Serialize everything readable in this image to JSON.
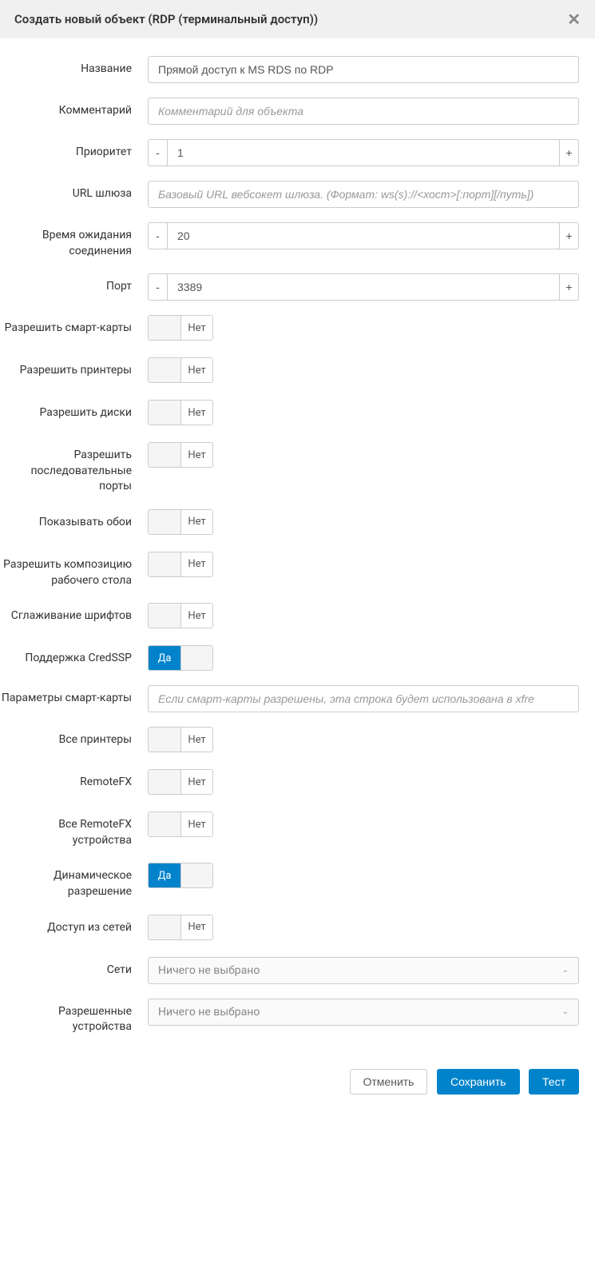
{
  "header": {
    "title": "Создать новый объект (RDP (терминальный доступ))"
  },
  "form": {
    "name": {
      "label": "Название",
      "value": "Прямой доступ к MS RDS по RDP"
    },
    "comment": {
      "label": "Комментарий",
      "placeholder": "Комментарий для объекта"
    },
    "priority": {
      "label": "Приоритет",
      "value": "1"
    },
    "gateway_url": {
      "label": "URL шлюза",
      "placeholder": "Базовый URL вебсокет шлюза. (Формат: ws(s)://<хост>[:порт][/путь])"
    },
    "conn_timeout": {
      "label": "Время ожидания соединения",
      "value": "20"
    },
    "port": {
      "label": "Порт",
      "value": "3389"
    },
    "allow_smartcards": {
      "label": "Разрешить смарт-карты",
      "value": "Нет",
      "on": false
    },
    "allow_printers": {
      "label": "Разрешить принтеры",
      "value": "Нет",
      "on": false
    },
    "allow_drives": {
      "label": "Разрешить диски",
      "value": "Нет",
      "on": false
    },
    "allow_serial": {
      "label": "Разрешить последовательные порты",
      "value": "Нет",
      "on": false
    },
    "show_wallpaper": {
      "label": "Показывать обои",
      "value": "Нет",
      "on": false
    },
    "allow_composition": {
      "label": "Разрешить композицию рабочего стола",
      "value": "Нет",
      "on": false
    },
    "font_smoothing": {
      "label": "Сглаживание шрифтов",
      "value": "Нет",
      "on": false
    },
    "credssp": {
      "label": "Поддержка CredSSP",
      "value": "Да",
      "on": true
    },
    "smartcard_params": {
      "label": "Параметры смарт-карты",
      "placeholder": "Если смарт-карты разрешены, эта строка будет использована в xfre"
    },
    "all_printers": {
      "label": "Все принтеры",
      "value": "Нет",
      "on": false
    },
    "remotefx": {
      "label": "RemoteFX",
      "value": "Нет",
      "on": false
    },
    "all_remotefx": {
      "label": "Все RemoteFX устройства",
      "value": "Нет",
      "on": false
    },
    "dynamic_res": {
      "label": "Динамическое разрешение",
      "value": "Да",
      "on": true
    },
    "net_access": {
      "label": "Доступ из сетей",
      "value": "Нет",
      "on": false
    },
    "networks": {
      "label": "Сети",
      "selected": "Ничего не выбрано"
    },
    "allowed_devices": {
      "label": "Разрешенные устройства",
      "selected": "Ничего не выбрано"
    }
  },
  "footer": {
    "cancel": "Отменить",
    "save": "Сохранить",
    "test": "Тест"
  }
}
